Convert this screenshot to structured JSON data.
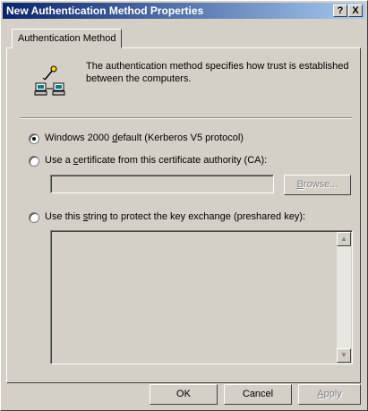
{
  "window": {
    "title": "New Authentication Method Properties",
    "help_label": "?",
    "close_label": "X"
  },
  "tabs": [
    {
      "label": "Authentication Method",
      "selected": true
    }
  ],
  "description": "The authentication method specifies how trust is established between the computers.",
  "icons": {
    "auth": "computers-linked-icon"
  },
  "options": [
    {
      "pre": "Windows 2000 ",
      "mnemonic": "d",
      "post": "efault (Kerberos V5 protocol)",
      "selected": true
    },
    {
      "pre": "Use a ",
      "mnemonic": "c",
      "post": "ertificate from this certificate authority (CA):",
      "selected": false
    },
    {
      "pre": "Use this ",
      "mnemonic": "s",
      "post": "tring to protect the key exchange (preshared key):",
      "selected": false
    }
  ],
  "certificate": {
    "value": "",
    "browse": {
      "mnemonic": "B",
      "rest": "rowse..."
    }
  },
  "preshared_key": {
    "value": ""
  },
  "buttons": {
    "ok": "OK",
    "cancel": "Cancel",
    "apply": {
      "mnemonic": "A",
      "rest": "pply"
    }
  },
  "colors": {
    "title_start": "#0a246a",
    "title_end": "#a6caf0",
    "face": "#d4d0c8"
  }
}
